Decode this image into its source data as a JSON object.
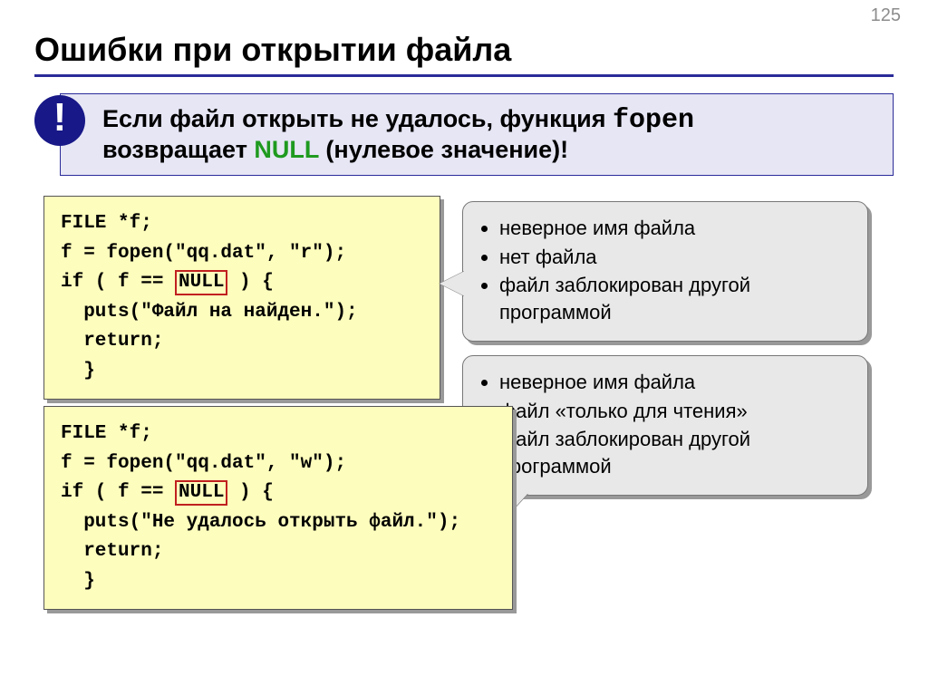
{
  "page_number": "125",
  "title": "Ошибки при открытии файла",
  "note": {
    "text_before_fn": "Если файл открыть не удалось, функция ",
    "fn": "fopen",
    "text_mid": " возвращает ",
    "null": "NULL",
    "text_after": " (нулевое значение)!"
  },
  "code1": {
    "l1": "FILE *f;",
    "l2_a": "f = fopen(\"qq.dat\", \"",
    "l2_mode": "r",
    "l2_b": "\");",
    "l3_a": "if ( f == ",
    "l3_null": "NULL",
    "l3_b": " ) {",
    "l4": "  puts(\"Файл на найден.\");",
    "l5": "  return;",
    "l6": "  }"
  },
  "callout1": {
    "items": [
      "неверное имя файла",
      "нет файла",
      "файл заблокирован другой программой"
    ]
  },
  "code2": {
    "l1": "FILE *f;",
    "l2_a": "f = fopen(\"qq.dat\", \"",
    "l2_mode": "w",
    "l2_b": "\");",
    "l3_a": "if ( f == ",
    "l3_null": "NULL",
    "l3_b": " ) {",
    "l4": "  puts(\"Не удалось открыть файл.\");",
    "l5": "  return;",
    "l6": "  }"
  },
  "callout2": {
    "items": [
      "неверное имя файла",
      "файл «только для чтения»",
      "файл заблокирован другой программой"
    ]
  }
}
